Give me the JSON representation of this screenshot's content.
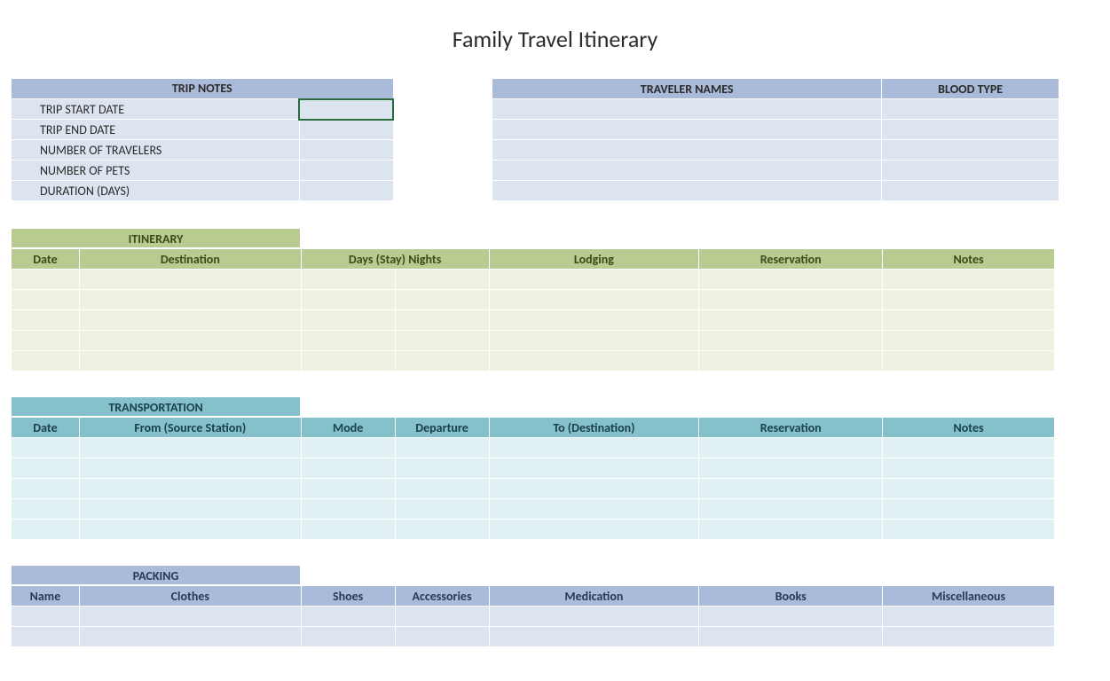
{
  "title": "Family Travel Itinerary",
  "tripNotes": {
    "header": "TRIP NOTES",
    "rows": [
      {
        "label": "TRIP START DATE",
        "value": ""
      },
      {
        "label": "TRIP END DATE",
        "value": ""
      },
      {
        "label": "NUMBER OF TRAVELERS",
        "value": ""
      },
      {
        "label": "NUMBER OF PETS",
        "value": ""
      },
      {
        "label": "DURATION (DAYS)",
        "value": ""
      }
    ]
  },
  "travelers": {
    "header1": "TRAVELER NAMES",
    "header2": "BLOOD TYPE",
    "rows": [
      {
        "name": "",
        "blood": ""
      },
      {
        "name": "",
        "blood": ""
      },
      {
        "name": "",
        "blood": ""
      },
      {
        "name": "",
        "blood": ""
      },
      {
        "name": "",
        "blood": ""
      }
    ]
  },
  "itinerary": {
    "title": "ITINERARY",
    "headers": [
      "Date",
      "Destination",
      "Days (Stay) Nights",
      "",
      "Lodging",
      "Reservation",
      "Notes"
    ],
    "rows": [
      [
        "",
        "",
        "",
        "",
        "",
        "",
        ""
      ],
      [
        "",
        "",
        "",
        "",
        "",
        "",
        ""
      ],
      [
        "",
        "",
        "",
        "",
        "",
        "",
        ""
      ],
      [
        "",
        "",
        "",
        "",
        "",
        "",
        ""
      ],
      [
        "",
        "",
        "",
        "",
        "",
        "",
        ""
      ]
    ]
  },
  "transportation": {
    "title": "TRANSPORTATION",
    "headers": [
      "Date",
      "From (Source Station)",
      "Mode",
      "Departure",
      "To (Destination)",
      "Reservation",
      "Notes"
    ],
    "rows": [
      [
        "",
        "",
        "",
        "",
        "",
        "",
        ""
      ],
      [
        "",
        "",
        "",
        "",
        "",
        "",
        ""
      ],
      [
        "",
        "",
        "",
        "",
        "",
        "",
        ""
      ],
      [
        "",
        "",
        "",
        "",
        "",
        "",
        ""
      ],
      [
        "",
        "",
        "",
        "",
        "",
        "",
        ""
      ]
    ]
  },
  "packing": {
    "title": "PACKING",
    "headers": [
      "Name",
      "Clothes",
      "Shoes",
      "Accessories",
      "Medication",
      "Books",
      "Miscellaneous"
    ],
    "rows": [
      [
        "",
        "",
        "",
        "",
        "",
        "",
        ""
      ],
      [
        "",
        "",
        "",
        "",
        "",
        "",
        ""
      ]
    ]
  }
}
